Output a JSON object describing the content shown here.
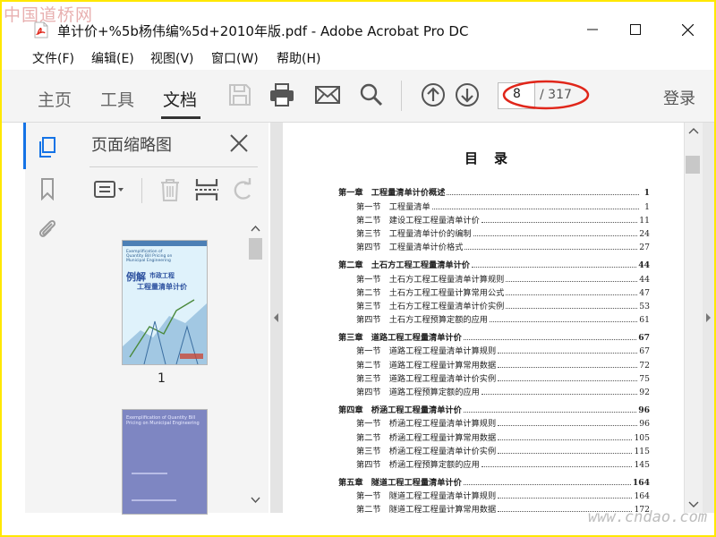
{
  "watermark_top": "中国道桥网",
  "watermark_bottom": "www.cndao.com",
  "window": {
    "title": "单计价+%5b杨伟编%5d+2010年版.pdf - Adobe Acrobat Pro DC",
    "icon": "pdf-file-icon"
  },
  "menu": {
    "items": [
      "文件(F)",
      "编辑(E)",
      "视图(V)",
      "窗口(W)",
      "帮助(H)"
    ]
  },
  "toolbar": {
    "tabs": [
      "主页",
      "工具",
      "文档"
    ],
    "active_tab": "文档",
    "icons": [
      "save-icon",
      "print-icon",
      "email-icon",
      "search-icon",
      "page-up-icon",
      "page-down-icon"
    ],
    "page_current": "8",
    "page_total": "/ 317",
    "login": "登录",
    "annotation_color": "#e0261a"
  },
  "left_rail": {
    "icons": [
      "page-thumbnails-icon",
      "bookmark-icon",
      "attachment-icon"
    ],
    "accent": "#1473e6"
  },
  "thumbnail_panel": {
    "title": "页面缩略图",
    "thumbnails": [
      {
        "label": "1",
        "cover_small": "Exemplification of Quantity Bill Pricing on Municipal Engineering",
        "cover_title_1": "例解",
        "cover_title_2": "市政工程",
        "cover_title_3": "工程量清单计价"
      },
      {
        "label": "",
        "cover_small": "Exemplification of Quantity Bill Pricing on Municipal Engineering"
      }
    ]
  },
  "document": {
    "title": "目录",
    "toc": [
      {
        "type": "chap",
        "label": "第一章　工程量清单计价概述",
        "page": "1"
      },
      {
        "type": "sec",
        "label": "第一节　工程量清单",
        "page": "1"
      },
      {
        "type": "sec",
        "label": "第二节　建设工程工程量清单计价",
        "page": "11"
      },
      {
        "type": "sec",
        "label": "第三节　工程量清单计价的编制",
        "page": "24"
      },
      {
        "type": "sec",
        "label": "第四节　工程量清单计价格式",
        "page": "27"
      },
      {
        "type": "chap",
        "label": "第二章　土石方工程工程量清单计价",
        "page": "44"
      },
      {
        "type": "sec",
        "label": "第一节　土石方工程工程量清单计算规则",
        "page": "44"
      },
      {
        "type": "sec",
        "label": "第二节　土石方工程工程量计算常用公式",
        "page": "47"
      },
      {
        "type": "sec",
        "label": "第三节　土石方工程工程量清单计价实例",
        "page": "53"
      },
      {
        "type": "sec",
        "label": "第四节　土石方工程预算定额的应用",
        "page": "61"
      },
      {
        "type": "chap",
        "label": "第三章　道路工程工程量清单计价",
        "page": "67"
      },
      {
        "type": "sec",
        "label": "第一节　道路工程工程量清单计算规则",
        "page": "67"
      },
      {
        "type": "sec",
        "label": "第二节　道路工程工程量计算常用数据",
        "page": "72"
      },
      {
        "type": "sec",
        "label": "第三节　道路工程工程量清单计价实例",
        "page": "75"
      },
      {
        "type": "sec",
        "label": "第四节　道路工程预算定额的应用",
        "page": "92"
      },
      {
        "type": "chap",
        "label": "第四章　桥涵工程工程量清单计价",
        "page": "96"
      },
      {
        "type": "sec",
        "label": "第一节　桥涵工程工程量清单计算规则",
        "page": "96"
      },
      {
        "type": "sec",
        "label": "第二节　桥涵工程工程量计算常用数据",
        "page": "105"
      },
      {
        "type": "sec",
        "label": "第三节　桥涵工程工程量清单计价实例",
        "page": "115"
      },
      {
        "type": "sec",
        "label": "第四节　桥涵工程预算定额的应用",
        "page": "145"
      },
      {
        "type": "chap",
        "label": "第五章　隧道工程工程量清单计价",
        "page": "164"
      },
      {
        "type": "sec",
        "label": "第一节　隧道工程工程量清单计算规则",
        "page": "164"
      },
      {
        "type": "sec",
        "label": "第二节　隧道工程工程量计算常用数据",
        "page": "172"
      }
    ]
  }
}
